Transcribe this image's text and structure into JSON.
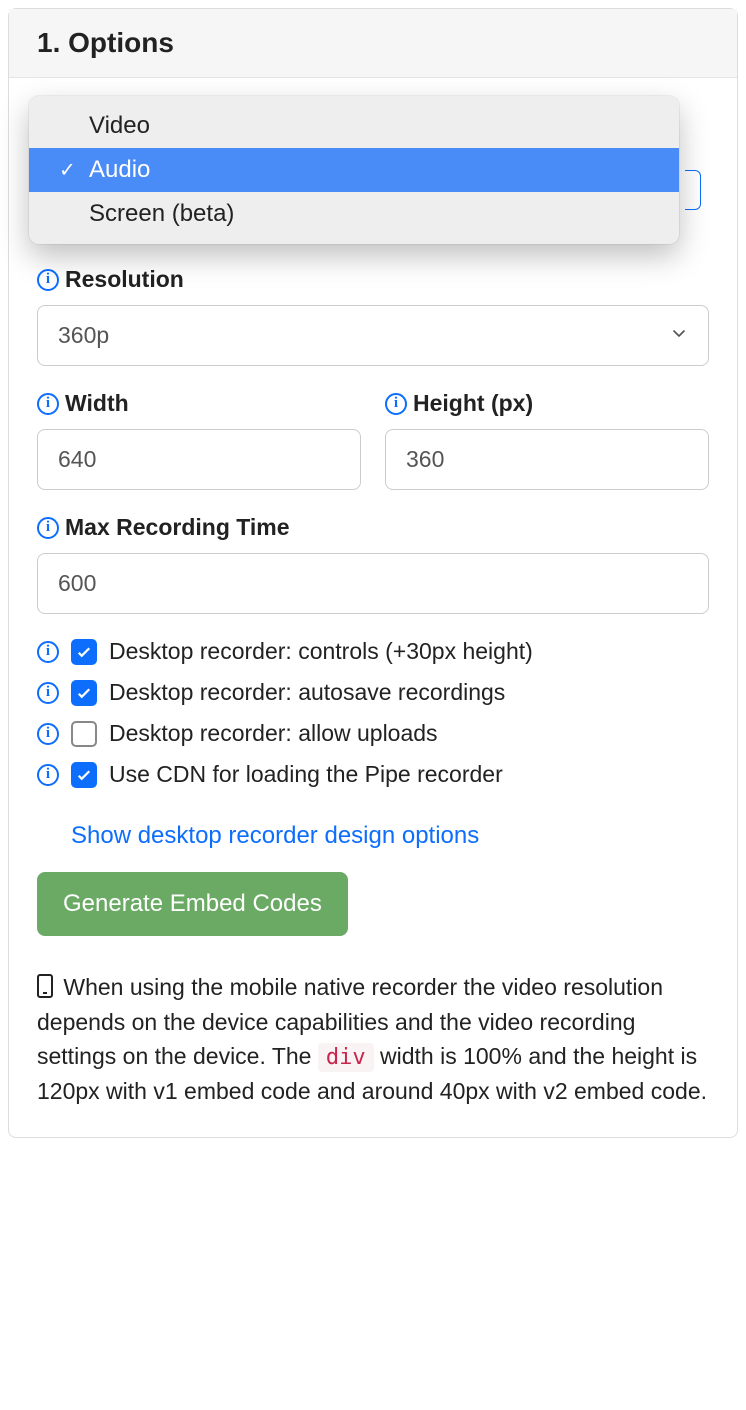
{
  "panel": {
    "title": "1. Options"
  },
  "dropdown": {
    "options": [
      "Video",
      "Audio",
      "Screen (beta)"
    ],
    "selected": "Audio"
  },
  "resolution": {
    "label": "Resolution",
    "value": "360p"
  },
  "width": {
    "label": "Width",
    "value": "640"
  },
  "height": {
    "label": "Height (px)",
    "value": "360"
  },
  "max_time": {
    "label": "Max Recording Time",
    "value": "600"
  },
  "checks": [
    {
      "label": "Desktop recorder: controls (+30px height)",
      "checked": true
    },
    {
      "label": "Desktop recorder: autosave recordings",
      "checked": true
    },
    {
      "label": "Desktop recorder: allow uploads",
      "checked": false
    },
    {
      "label": "Use CDN for loading the Pipe recorder",
      "checked": true
    }
  ],
  "design_link": "Show desktop recorder design options",
  "generate_button": "Generate Embed Codes",
  "note": {
    "prefix": "When using the mobile native recorder the video resolution depends on the device capabilities and the video recording settings on the device. The ",
    "code": "div",
    "suffix": " width is 100% and the height is 120px with v1 embed code and around 40px with v2 embed code."
  }
}
